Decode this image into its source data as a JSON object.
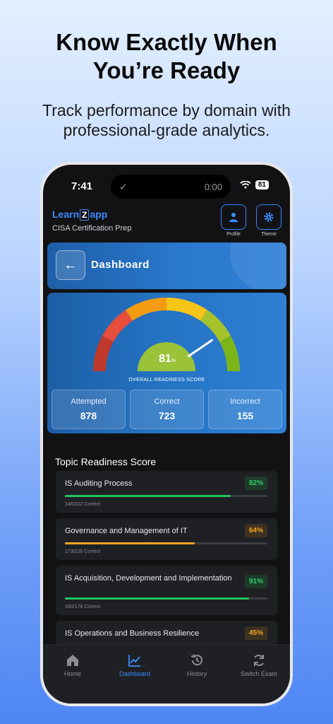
{
  "promo": {
    "headline_line1": "Know Exactly When",
    "headline_line2": "You’re Ready",
    "subline_line1": "Track performance by domain with",
    "subline_line2": "professional-grade analytics."
  },
  "status_bar": {
    "time": "7:41",
    "timer": "0:00",
    "battery": "81"
  },
  "header": {
    "logo_left": "Learn",
    "logo_z": "Z",
    "logo_right": "app",
    "subtitle": "CISA Certification Prep",
    "profile_label": "Profile",
    "theme_label": "Theme"
  },
  "banner": {
    "title": "Dashboard"
  },
  "readiness": {
    "score": "81",
    "score_unit": "%",
    "score_fraction": 0.81,
    "label": "OVERALL READINESS SCORE",
    "stats": [
      {
        "label": "Attempted",
        "value": "878"
      },
      {
        "label": "Correct",
        "value": "723"
      },
      {
        "label": "Incorrect",
        "value": "155"
      }
    ]
  },
  "topics": {
    "title": "Topic Readiness Score",
    "items": [
      {
        "name": "IS Auditing Process",
        "percent": "82%",
        "fraction": 0.82,
        "count": "146/222 Correct",
        "color": "#22c55e"
      },
      {
        "name": "Governance and Management of IT",
        "percent": "64%",
        "fraction": 0.64,
        "count": "173/226 Correct",
        "color": "#f5a623"
      },
      {
        "name": "IS Acquisition, Development and Implementation",
        "percent": "91%",
        "fraction": 0.91,
        "count": "160/178 Correct",
        "color": "#22c55e"
      },
      {
        "name": "IS Operations and Business Resilience",
        "percent": "45%",
        "fraction": 0.45,
        "count": "",
        "color": "#f5a623"
      }
    ]
  },
  "tabs": [
    {
      "label": "Home",
      "icon": "home-icon"
    },
    {
      "label": "Dashboard",
      "icon": "chart-icon"
    },
    {
      "label": "History",
      "icon": "history-icon"
    },
    {
      "label": "Switch Exam",
      "icon": "refresh-icon"
    }
  ],
  "colors": {
    "accent": "#3b8bff",
    "success": "#22c55e",
    "warning": "#f5a623"
  }
}
